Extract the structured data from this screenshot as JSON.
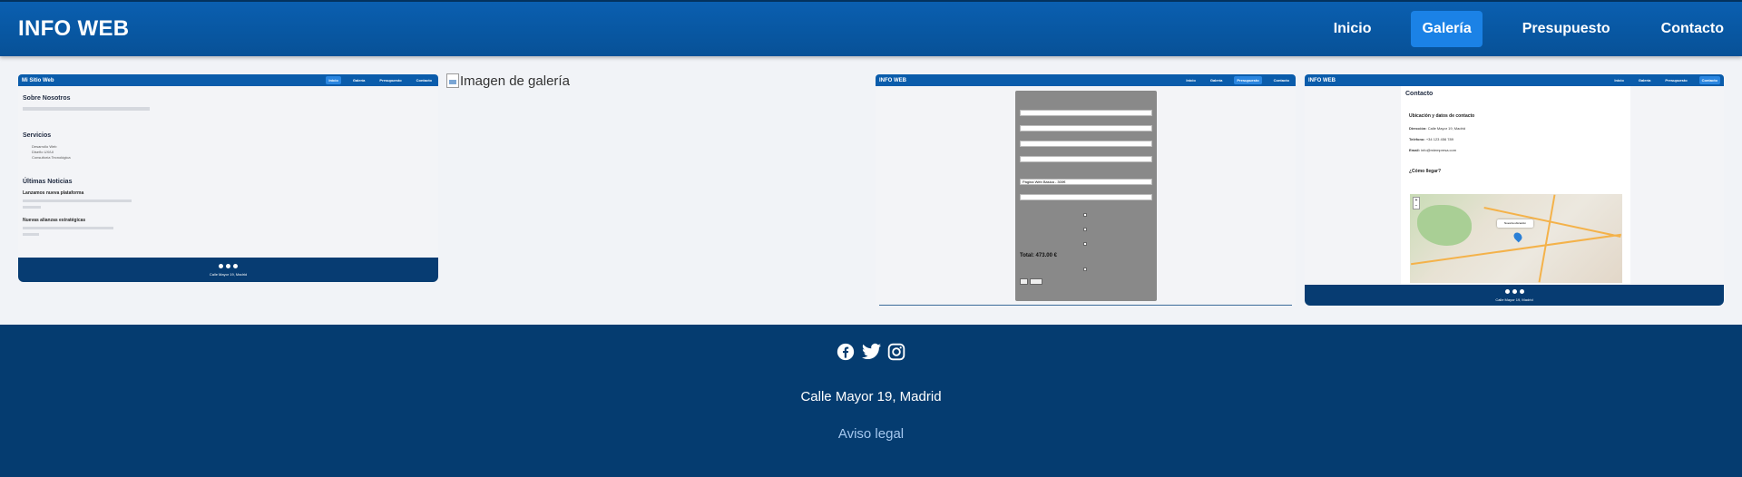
{
  "header": {
    "brand": "INFO WEB",
    "nav": [
      {
        "label": "Inicio",
        "active": false
      },
      {
        "label": "Galería",
        "active": true
      },
      {
        "label": "Presupuesto",
        "active": false
      },
      {
        "label": "Contacto",
        "active": false
      }
    ]
  },
  "gallery": {
    "broken_image_alt": "Imagen de galería",
    "thumb1": {
      "brand": "Mi Sitio Web",
      "nav": [
        "Inicio",
        "Galería",
        "Presupuesto",
        "Contacto"
      ],
      "about_title": "Sobre Nosotros",
      "services_title": "Servicios",
      "services": [
        "Desarrollo Web",
        "Diseño UX/UI",
        "Consultoría Tecnológica"
      ],
      "news_title": "Últimas Noticias",
      "news": [
        {
          "title": "Lanzamos nueva plataforma"
        },
        {
          "title": "Nuevas alianzas estratégicas"
        }
      ],
      "address": "Calle Mayor 19, Madrid"
    },
    "thumb3": {
      "brand": "INFO WEB",
      "nav": [
        "Inicio",
        "Galería",
        "Presupuesto",
        "Contacto"
      ],
      "total": "Total: 473.00 €",
      "select_value": "Página Web Básica - 300€"
    },
    "thumb4": {
      "brand": "INFO WEB",
      "nav": [
        "Inicio",
        "Galería",
        "Presupuesto",
        "Contacto"
      ],
      "title": "Contacto",
      "subtitle": "Ubicación y datos de contacto",
      "lines": [
        {
          "label": "Dirección:",
          "value": "Calle Mayor 19, Madrid"
        },
        {
          "label": "Teléfono:",
          "value": "+34 123 456 789"
        },
        {
          "label": "Email:",
          "value": "info@miempresa.com"
        }
      ],
      "how_to_get": "¿Cómo llegar?",
      "map_tooltip": "Nuestra ubicación",
      "address": "Calle Mayor 19, Madrid"
    }
  },
  "footer": {
    "social": [
      "facebook-icon",
      "twitter-icon",
      "instagram-icon"
    ],
    "address": "Calle Mayor 19, Madrid",
    "legal": "Aviso legal"
  }
}
